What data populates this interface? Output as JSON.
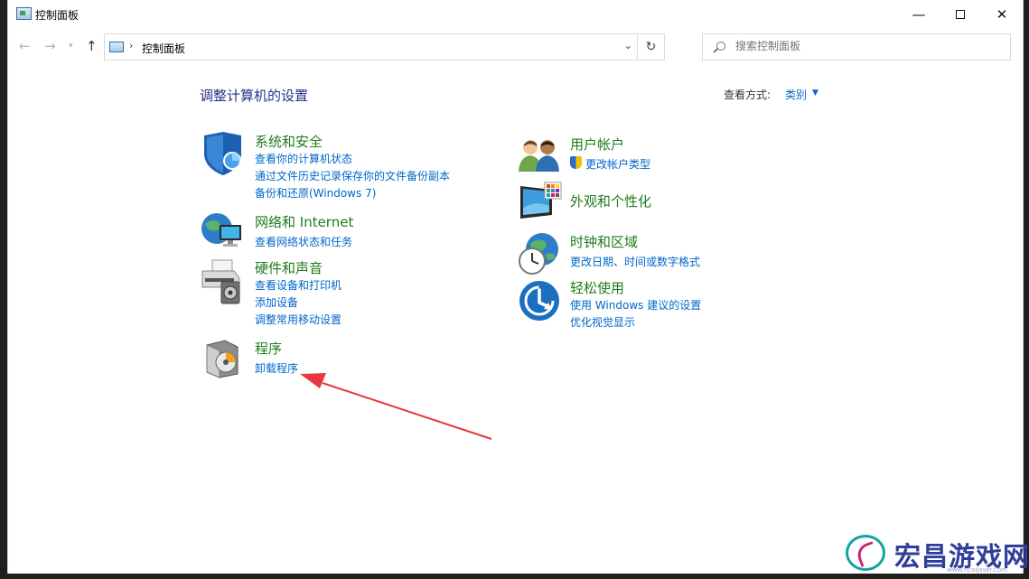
{
  "window": {
    "title": "控制面板",
    "controls": {
      "minimize": "—",
      "maximize": "",
      "close": "✕"
    }
  },
  "nav": {
    "back": "←",
    "forward": "→",
    "recent": "▾",
    "up": "↑",
    "address": "控制面板",
    "address_chevron": "›",
    "address_dropdown": "⌄",
    "refresh": "↻",
    "search_placeholder": "搜索控制面板"
  },
  "main": {
    "heading": "调整计算机的设置",
    "view_by_label": "查看方式:",
    "view_by_value": "类别",
    "view_by_caret": "▼"
  },
  "categories_left": [
    {
      "icon": "shield-icon",
      "title": "系统和安全",
      "links": [
        "查看你的计算机状态",
        "通过文件历史记录保存你的文件备份副本",
        "备份和还原(Windows 7)"
      ]
    },
    {
      "icon": "network-icon",
      "title": "网络和 Internet",
      "links": [
        "查看网络状态和任务"
      ]
    },
    {
      "icon": "printer-icon",
      "title": "硬件和声音",
      "links": [
        "查看设备和打印机",
        "添加设备",
        "调整常用移动设置"
      ]
    },
    {
      "icon": "programs-icon",
      "title": "程序",
      "links": [
        "卸载程序"
      ]
    }
  ],
  "categories_right": [
    {
      "icon": "users-icon",
      "title": "用户帐户",
      "links": [
        "更改帐户类型"
      ]
    },
    {
      "icon": "appearance-icon",
      "title": "外观和个性化",
      "links": []
    },
    {
      "icon": "clock-globe-icon",
      "title": "时钟和区域",
      "links": [
        "更改日期、时间或数字格式"
      ]
    },
    {
      "icon": "ease-of-access-icon",
      "title": "轻松使用",
      "links": [
        "使用 Windows 建议的设置",
        "优化视觉显示"
      ]
    }
  ],
  "annotation": {
    "color": "#e8383d"
  },
  "watermark": {
    "text": "宏昌游戏网",
    "sub": "www.hcaijaser.com"
  },
  "colors": {
    "heading": "#1e3287",
    "category": "#1e7b1e",
    "link": "#0066cc"
  }
}
